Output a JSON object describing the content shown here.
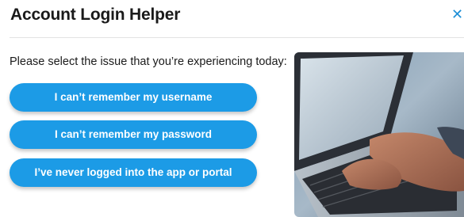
{
  "dialog": {
    "title": "Account Login Helper",
    "close_icon": "close-icon",
    "prompt": "Please select the issue that you’re experiencing today:",
    "options": [
      {
        "label": "I can’t remember my username"
      },
      {
        "label": "I can’t remember my password"
      },
      {
        "label": "I’ve never logged into the app or portal"
      }
    ],
    "image": "laptop-typing-photo"
  },
  "colors": {
    "accent": "#1c9be6",
    "close": "#1d8fd6",
    "title": "#1a1a1a",
    "divider": "#e2e2e2"
  }
}
